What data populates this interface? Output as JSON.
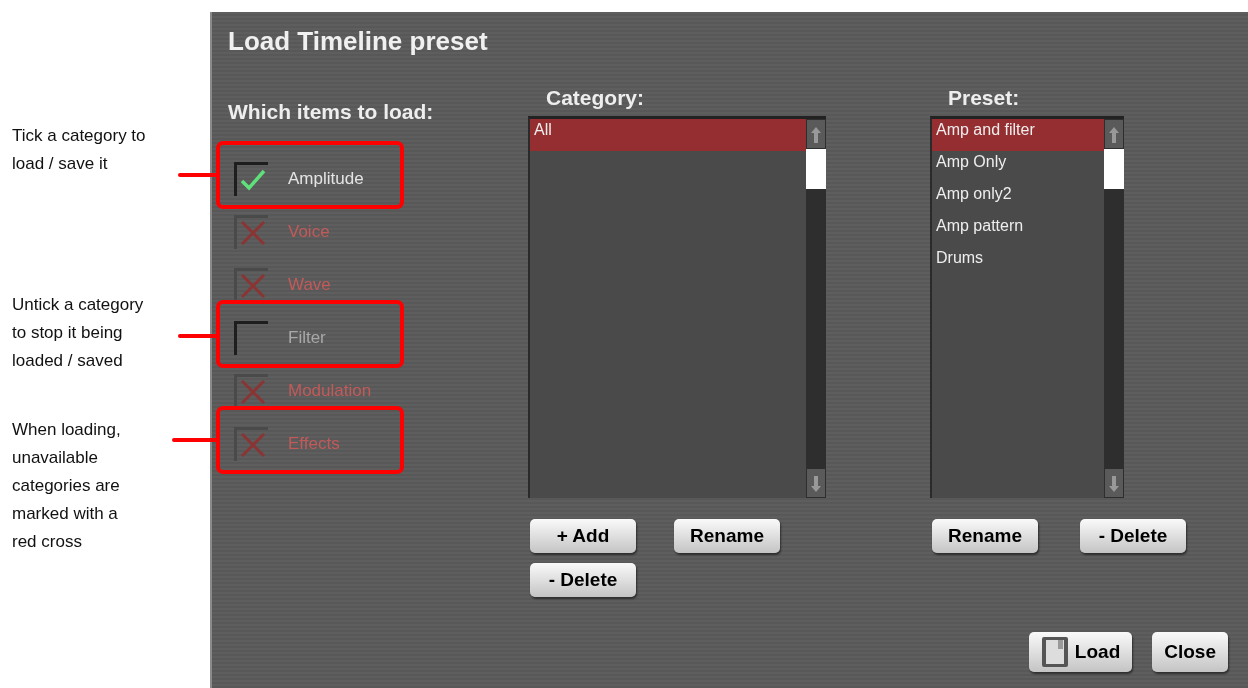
{
  "annotations": [
    {
      "text": "Tick a category to load / save it"
    },
    {
      "text": "Untick a category to stop it being loaded / saved"
    },
    {
      "text": "When loading, unavailable categories are marked with a red cross"
    }
  ],
  "dialog": {
    "title": "Load Timeline preset",
    "items_heading": "Which items to load:",
    "items": [
      {
        "label": "Amplitude",
        "kind": "checked",
        "highlighted": true
      },
      {
        "label": "Voice",
        "kind": "unavailable",
        "highlighted": false
      },
      {
        "label": "Wave",
        "kind": "unavailable",
        "highlighted": false
      },
      {
        "label": "Filter",
        "kind": "unchecked",
        "highlighted": true
      },
      {
        "label": "Modulation",
        "kind": "unavailable",
        "highlighted": false
      },
      {
        "label": "Effects",
        "kind": "unavailable",
        "highlighted": true
      }
    ],
    "category": {
      "heading": "Category:",
      "items": [
        {
          "label": "All",
          "selected": true
        }
      ],
      "buttons": [
        "+ Add",
        "Rename",
        "- Delete"
      ]
    },
    "preset": {
      "heading": "Preset:",
      "items": [
        {
          "label": "Amp and filter",
          "selected": true
        },
        {
          "label": "Amp Only",
          "selected": false
        },
        {
          "label": "Amp only2",
          "selected": false
        },
        {
          "label": "Amp pattern",
          "selected": false
        },
        {
          "label": "Drums",
          "selected": false
        }
      ],
      "buttons": [
        "Rename",
        "- Delete"
      ]
    },
    "footer_buttons": [
      {
        "label": "Load",
        "kind": "icon"
      },
      {
        "label": "Close",
        "kind": "plain"
      }
    ]
  }
}
